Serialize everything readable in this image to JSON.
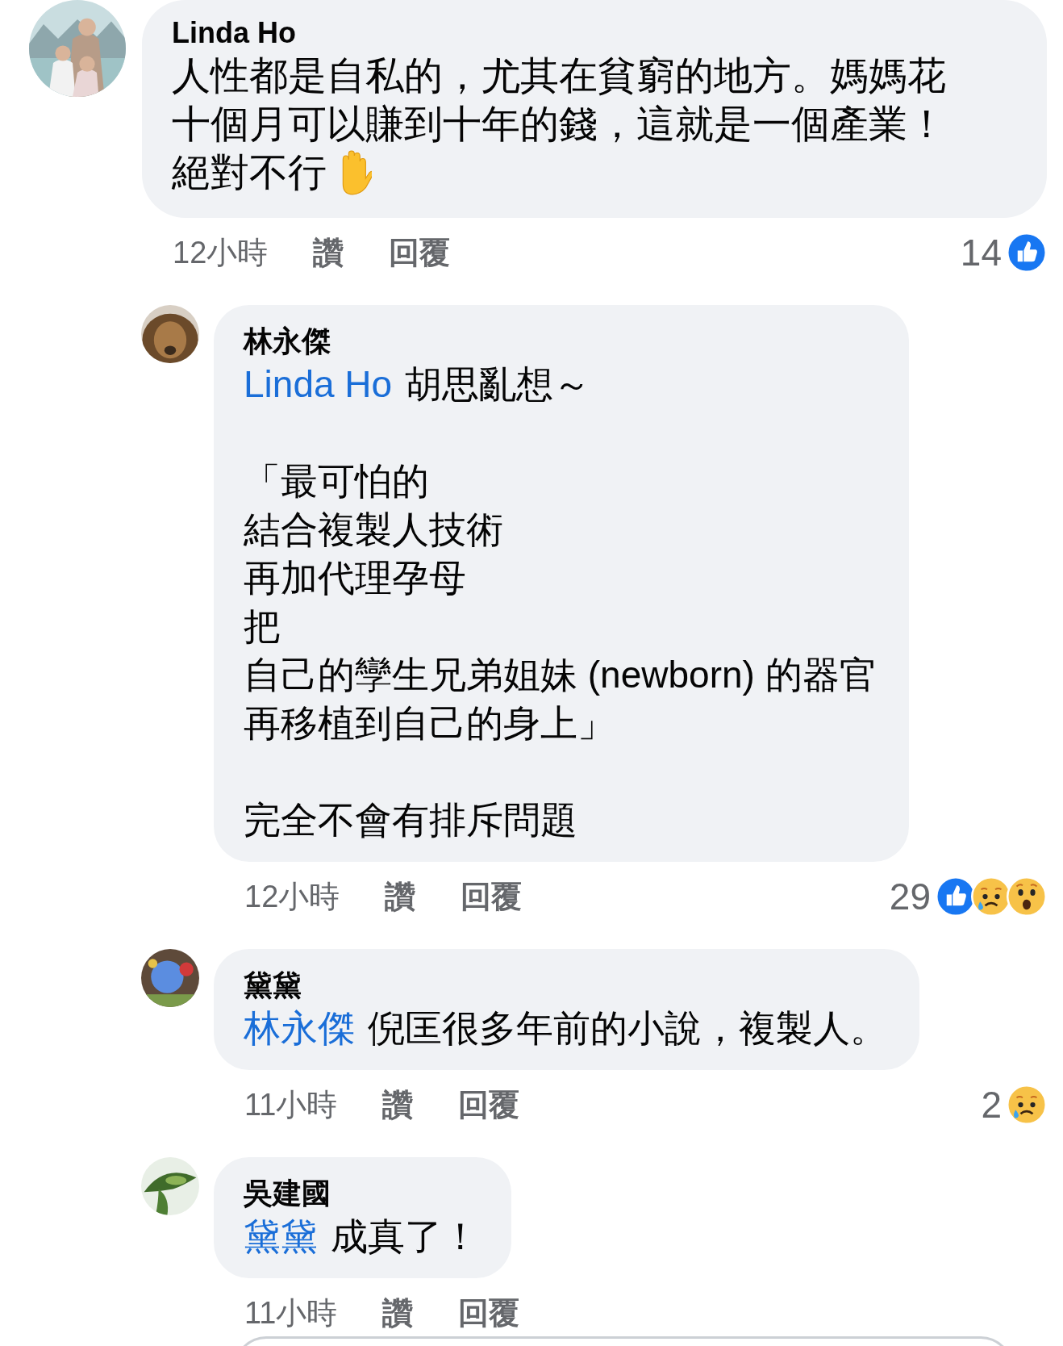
{
  "comments": [
    {
      "author": "Linda Ho",
      "avatar": {
        "kind": "picture"
      },
      "paragraphs": [
        [
          "人性都是自私的，尤其在貧窮的地方。媽媽花",
          "十個月可以賺到十年的錢，這就是一個產業！",
          "絕對不行"
        ]
      ],
      "emoji": {
        "kind": "raised-hand"
      },
      "time": "12小時",
      "like_label": "讚",
      "reply_label": "回覆",
      "reaction_count": "14",
      "reactions": [
        {
          "kind": "like"
        }
      ],
      "replies": [
        {
          "author": "林永傑",
          "avatar": {
            "kind": "picture"
          },
          "mention": "Linda Ho",
          "mention_text": "胡思亂想～",
          "paragraphs": [
            [
              "「最可怕的",
              "結合複製人技術",
              "再加代理孕母",
              "把",
              "自己的孿生兄弟姐妹 (newborn) 的器官",
              "再移植到自己的身上」"
            ],
            [
              "完全不會有排斥問題"
            ]
          ],
          "time": "12小時",
          "like_label": "讚",
          "reply_label": "回覆",
          "reaction_count": "29",
          "reactions": [
            {
              "kind": "like"
            },
            {
              "kind": "sad"
            },
            {
              "kind": "wow"
            }
          ]
        },
        {
          "author": "黛黛",
          "avatar": {
            "kind": "picture"
          },
          "mention": "林永傑",
          "mention_text": "倪匡很多年前的小說，複製人。",
          "time": "11小時",
          "like_label": "讚",
          "reply_label": "回覆",
          "reaction_count": "2",
          "reactions": [
            {
              "kind": "sad"
            }
          ]
        },
        {
          "author": "吳建國",
          "avatar": {
            "kind": "picture"
          },
          "mention": "黛黛",
          "mention_text": "成真了！",
          "time": "11小時",
          "like_label": "讚",
          "reply_label": "回覆"
        }
      ]
    }
  ]
}
